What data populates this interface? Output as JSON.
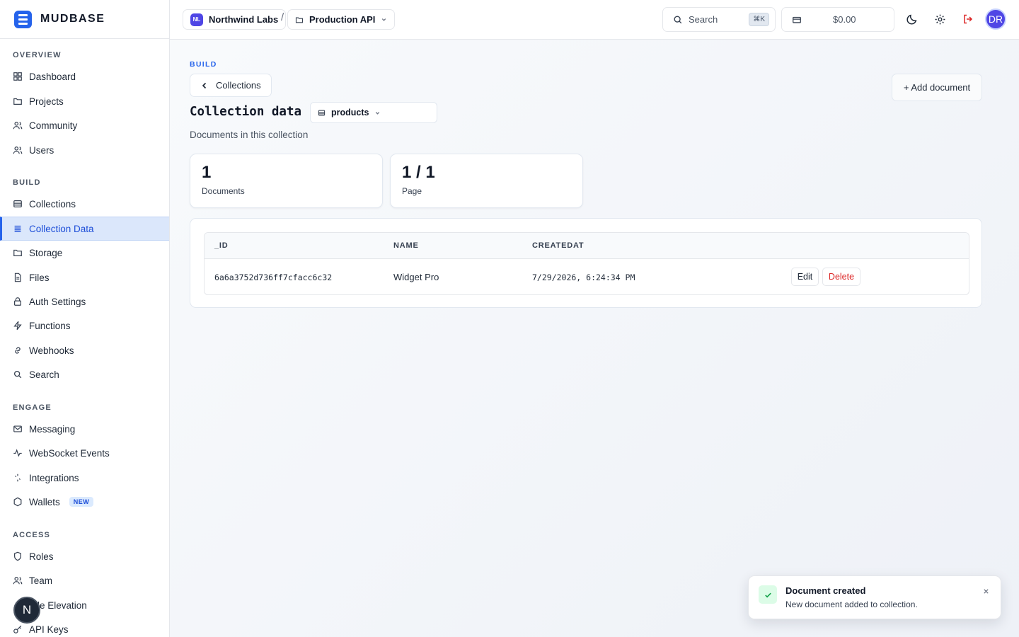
{
  "brand": {
    "name": "MUDBASE"
  },
  "sidebar": {
    "sections": {
      "overview": "OVERVIEW",
      "build": "BUILD",
      "engage": "ENGAGE",
      "access": "ACCESS"
    },
    "items": {
      "dashboard": "Dashboard",
      "projects": "Projects",
      "community": "Community",
      "users": "Users",
      "collections": "Collections",
      "collection_data": "Collection Data",
      "storage": "Storage",
      "files": "Files",
      "auth_settings": "Auth Settings",
      "functions": "Functions",
      "webhooks": "Webhooks",
      "search": "Search",
      "messaging": "Messaging",
      "websocket_events": "WebSocket Events",
      "integrations": "Integrations",
      "wallets": "Wallets",
      "wallets_badge": "NEW",
      "roles": "Roles",
      "team": "Team",
      "role_elevation": "le Elevation",
      "api_keys": "API Keys"
    },
    "active": "collection_data"
  },
  "topbar": {
    "org_initials": "NL",
    "org_name": "Northwind Labs",
    "separator": "/",
    "project_name": "Production API",
    "search_label": "Search",
    "search_shortcut": "⌘K",
    "balance": "$0.00",
    "avatar_initials": "DR"
  },
  "main": {
    "section_label": "BUILD",
    "back_label": "Collections",
    "add_label": "+ Add document",
    "title": "Collection data",
    "collection_selected": "products",
    "subtitle": "Documents in this collection",
    "stats": [
      {
        "value": "1",
        "label": "Documents"
      },
      {
        "value": "1 / 1",
        "label": "Page"
      }
    ],
    "table": {
      "columns": [
        "_ID",
        "NAME",
        "CREATEDAT"
      ],
      "rows": [
        {
          "id": "6a6a3752d736ff7cfacc6c32",
          "name": "Widget Pro",
          "created": "7/29/2026, 6:24:34 PM",
          "edit": "Edit",
          "delete": "Delete"
        }
      ]
    }
  },
  "toast": {
    "title": "Document created",
    "body": "New document added to collection."
  },
  "bubble": {
    "letter": "N"
  },
  "colors": {
    "accent": "#2563eb",
    "danger": "#dc2626",
    "success": "#16a34a",
    "org_badge": "#4f46e5"
  }
}
